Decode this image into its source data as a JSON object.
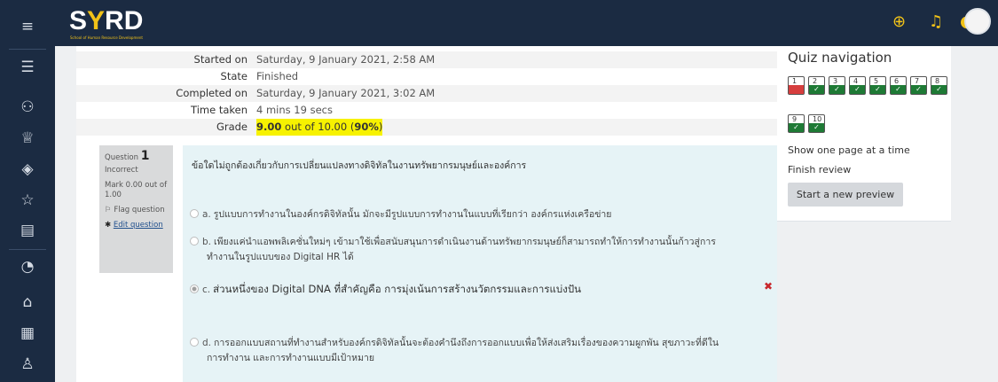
{
  "brand": {
    "logo_left": "S",
    "logo_mid": "Y",
    "logo_right": "RD",
    "subtitle": "School of Human Resource Development"
  },
  "icons": {
    "sidebar": [
      "menu-icon",
      "list-icon",
      "users-icon",
      "award-icon",
      "layers-icon",
      "star-icon",
      "book-icon",
      "gauge-icon",
      "home-icon",
      "calendar-icon",
      "graduation-cap-icon"
    ],
    "topbar": [
      "globe-icon",
      "bell-icon",
      "chat-icon"
    ]
  },
  "summary": [
    {
      "label": "Started on",
      "value": "Saturday, 9 January 2021, 2:58 AM"
    },
    {
      "label": "State",
      "value": "Finished"
    },
    {
      "label": "Completed on",
      "value": "Saturday, 9 January 2021, 3:02 AM"
    },
    {
      "label": "Time taken",
      "value": "4 mins 19 secs"
    },
    {
      "label": "Grade",
      "score": "9.00",
      "mid": " out of 10.00 (",
      "pct": "90%",
      "end": ")"
    }
  ],
  "question": {
    "label": "Question",
    "number": "1",
    "status": "Incorrect",
    "mark": "Mark 0.00 out of 1.00",
    "flag": "Flag question",
    "edit": "Edit question",
    "text": "ข้อใดไม่ถูกต้องเกี่ยวกับการเปลี่ยนแปลงทางดิจิทัลในงานทรัพยากรมนุษย์และองค์การ",
    "options": [
      {
        "letter": "a.",
        "line1": "รูปแบบการทำงานในองค์กรดิจิทัลนั้น มักจะมีรูปแบบการทำงานในแบบที่เรียกว่า องค์กรแห่งเครือข่าย",
        "line2": ""
      },
      {
        "letter": "b.",
        "line1": "เพียงแค่นำแอพพลิเคชั่นใหม่ๆ เข้ามาใช้เพื่อสนับสนุนการดำเนินงานด้านทรัพยากรมนุษย์ก็สามารถทำให้การทำงานนั้นก้าวสู่การ",
        "line2": "ทำงานในรูปแบบของ Digital HR ได้"
      },
      {
        "letter": "c.",
        "line1": "ส่วนหนึ่งของ Digital DNA ที่สำคัญคือ การมุ่งเน้นการสร้างนวัตกรรมและการแบ่งปัน",
        "line2": ""
      },
      {
        "letter": "d.",
        "line1": "การออกแบบสถานที่ทำงานสำหรับองค์กรดิจิทัลนั้นจะต้องคำนึงถึงการออกแบบเพื่อให้ส่งเสริมเรื่องของความผูกพัน สุขภาวะที่ดีใน",
        "line2": "การทำงาน และการทำงานแบบมีเป้าหมาย"
      }
    ],
    "selected_option": "c.",
    "wrong_mark": "✖"
  },
  "quiz_nav": {
    "title": "Quiz navigation",
    "buttons": [
      {
        "n": "1",
        "state": "incorrect"
      },
      {
        "n": "2",
        "state": "correct"
      },
      {
        "n": "3",
        "state": "correct"
      },
      {
        "n": "4",
        "state": "correct"
      },
      {
        "n": "5",
        "state": "correct"
      },
      {
        "n": "6",
        "state": "correct"
      },
      {
        "n": "7",
        "state": "correct"
      },
      {
        "n": "8",
        "state": "correct"
      },
      {
        "n": "9",
        "state": "correct"
      },
      {
        "n": "10",
        "state": "correct"
      }
    ],
    "check_glyph": "✓",
    "show_one_page": "Show one page at a time",
    "finish_review": "Finish review",
    "start_preview": "Start a new preview"
  },
  "colors": {
    "nav_bg": "#1b2b42",
    "accent": "#f2c318",
    "correct": "#1e7a35",
    "incorrect": "#d63e3e",
    "highlight": "#f7f200"
  }
}
